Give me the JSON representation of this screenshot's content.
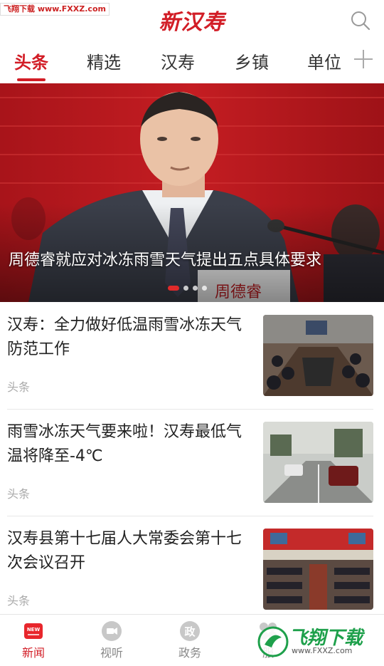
{
  "watermark": {
    "top_left": "飞翔下载 www.FXXZ.com",
    "bottom_right_big": "飞翔下载",
    "bottom_right_small": "www.FXXZ.com"
  },
  "header": {
    "logo_text": "新汉寿"
  },
  "tabs": [
    {
      "label": "头条",
      "active": true
    },
    {
      "label": "精选",
      "active": false
    },
    {
      "label": "汉寿",
      "active": false
    },
    {
      "label": "乡镇",
      "active": false
    },
    {
      "label": "单位",
      "active": false
    }
  ],
  "banner": {
    "title": "周德睿就应对冰冻雨雪天气提出五点具体要求",
    "slide_count": 4,
    "active_slide": 1
  },
  "news": [
    {
      "title": "汉寿：全力做好低温雨雪冰冻天气防范工作",
      "tag": "头条"
    },
    {
      "title": "雨雪冰冻天气要来啦！汉寿最低气温将降至-4℃",
      "tag": "头条"
    },
    {
      "title": "汉寿县第十七届人大常委会第十七次会议召开",
      "tag": "头条"
    }
  ],
  "bottom_nav": [
    {
      "label": "新闻",
      "icon": "news-icon",
      "active": true
    },
    {
      "label": "视听",
      "icon": "video-icon",
      "active": false
    },
    {
      "label": "政务",
      "icon": "government-icon",
      "active": false
    },
    {
      "label": "服",
      "icon": "service-icon",
      "active": false
    }
  ],
  "colors": {
    "accent": "#d21d26",
    "tag_gray": "#aaaaaa"
  }
}
